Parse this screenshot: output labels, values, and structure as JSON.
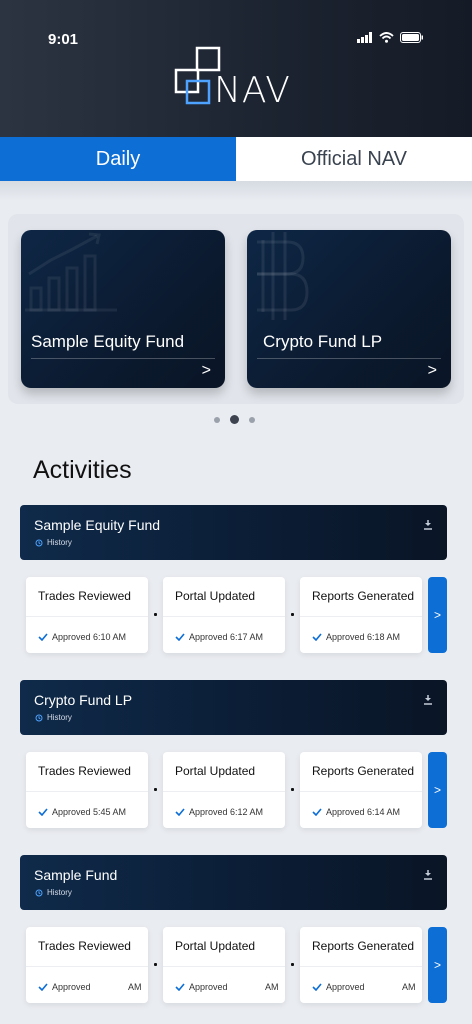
{
  "status_bar": {
    "time": "9:01"
  },
  "header": {
    "logo_text": "NAV"
  },
  "tabs": [
    {
      "label": "Daily",
      "active": true
    },
    {
      "label": "Official NAV",
      "active": false
    }
  ],
  "funds_carousel": {
    "cards": [
      {
        "name": "Sample Equity Fund",
        "arrow": ">"
      },
      {
        "name": "Crypto Fund LP",
        "arrow": ">"
      }
    ],
    "page_count": 3,
    "active_page": 2
  },
  "activities": {
    "title": "Activities",
    "groups": [
      {
        "fund": "Sample Equity Fund",
        "history_label": "History",
        "steps": [
          {
            "label": "Trades Reviewed",
            "status": "Approved 6:10 AM"
          },
          {
            "label": "Portal Updated",
            "status": "Approved 6:17 AM"
          },
          {
            "label": "Reports Generated",
            "status": "Approved 6:18 AM"
          }
        ],
        "go": ">"
      },
      {
        "fund": "Crypto Fund LP",
        "history_label": "History",
        "steps": [
          {
            "label": "Trades Reviewed",
            "status": "Approved 5:45 AM"
          },
          {
            "label": "Portal Updated",
            "status": "Approved 6:12 AM"
          },
          {
            "label": "Reports Generated",
            "status": "Approved 6:14 AM"
          }
        ],
        "go": ">"
      },
      {
        "fund": "Sample Fund",
        "history_label": "History",
        "steps": [
          {
            "label": "Trades Reviewed",
            "status": "Approved",
            "status_suffix": "AM"
          },
          {
            "label": "Portal Updated",
            "status": "Approved",
            "status_suffix": "AM"
          },
          {
            "label": "Reports Generated",
            "status": "Approved",
            "status_suffix": "AM"
          }
        ],
        "go": ">"
      }
    ]
  },
  "colors": {
    "accent": "#0d6ed6",
    "navy": "#0b1c33",
    "page_bg": "#e9ecf1"
  }
}
